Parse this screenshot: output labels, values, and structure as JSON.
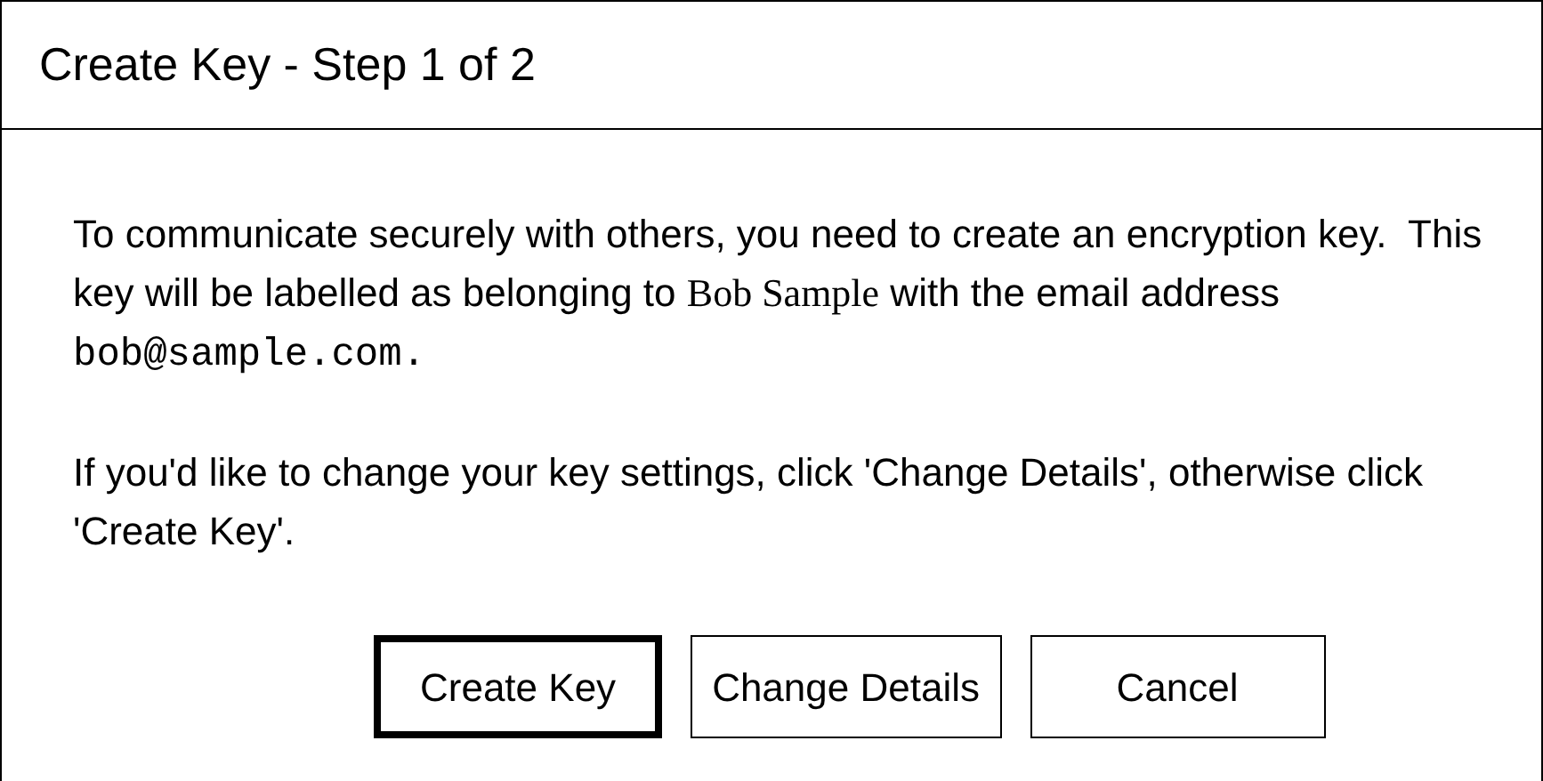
{
  "window": {
    "title": "Create Key - Step 1 of 2"
  },
  "paragraphs": [
    {
      "segments": [
        {
          "kind": "sans",
          "text": "To communicate securely with others, you need to create an encryption key.  This key will be labelled as belonging to "
        },
        {
          "kind": "serif",
          "text": "Bob Sample"
        },
        {
          "kind": "sans",
          "text": " with the email address "
        },
        {
          "kind": "mono",
          "text": "bob@sample.com."
        }
      ]
    },
    {
      "segments": [
        {
          "kind": "sans",
          "text": "If you'd like to change your key settings, click 'Change Details', otherwise click 'Create Key'."
        }
      ]
    }
  ],
  "buttons": [
    {
      "label": "Create Key",
      "default": true
    },
    {
      "label": "Change Details",
      "default": false
    },
    {
      "label": "Cancel",
      "default": false
    }
  ]
}
